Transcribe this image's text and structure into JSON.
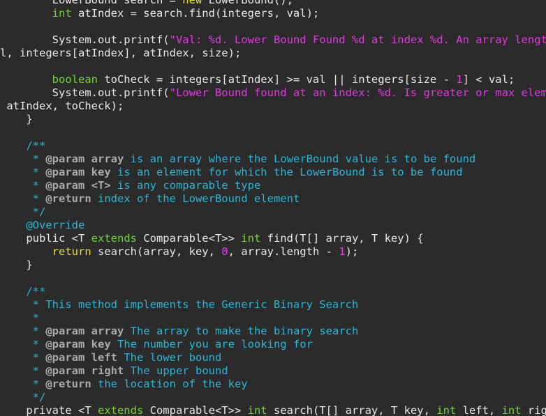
{
  "editor": {
    "colors": {
      "background": "#2b2b2b",
      "plain": "#e8e8e8",
      "keyword": "#e6de2b",
      "type": "#74d433",
      "string": "#de3bde",
      "number": "#ee3bee",
      "comment": "#2bb6d6",
      "javadoc_tag": "#a9a9a9",
      "javadoc_param": "#a9a9a9",
      "annotation": "#2bb6d6"
    },
    "lines": [
      [
        [
          "plain",
          "        LowerBound search = "
        ],
        [
          "keyword",
          "new"
        ],
        [
          "plain",
          " LowerBound();"
        ]
      ],
      [
        [
          "plain",
          "        "
        ],
        [
          "type",
          "int"
        ],
        [
          "plain",
          " atIndex = search.find(integers, val);"
        ]
      ],
      [
        [
          "plain",
          ""
        ]
      ],
      [
        [
          "plain",
          "        System.out.printf("
        ],
        [
          "string",
          "\"Val: %d. Lower Bound Found %d at index %d. An array length %"
        ]
      ],
      [
        [
          "plain",
          "l, integers[atIndex], atIndex, size);"
        ]
      ],
      [
        [
          "plain",
          ""
        ]
      ],
      [
        [
          "plain",
          "        "
        ],
        [
          "type",
          "boolean"
        ],
        [
          "plain",
          " toCheck = integers[atIndex] >= val || integers[size - "
        ],
        [
          "number",
          "1"
        ],
        [
          "plain",
          "] < val;"
        ]
      ],
      [
        [
          "plain",
          "        System.out.printf("
        ],
        [
          "string",
          "\"Lower Bound found at an index: %d. Is greater or max element"
        ]
      ],
      [
        [
          "plain",
          " atIndex, toCheck);"
        ]
      ],
      [
        [
          "plain",
          "    }"
        ]
      ],
      [
        [
          "plain",
          ""
        ]
      ],
      [
        [
          "comment",
          "    /**"
        ]
      ],
      [
        [
          "comment",
          "     * "
        ],
        [
          "javadoc_tag",
          "@param"
        ],
        [
          "comment",
          " "
        ],
        [
          "javadoc_param",
          "array"
        ],
        [
          "comment",
          " is an array where the LowerBound value is to be found"
        ]
      ],
      [
        [
          "comment",
          "     * "
        ],
        [
          "javadoc_tag",
          "@param"
        ],
        [
          "comment",
          " "
        ],
        [
          "javadoc_param",
          "key"
        ],
        [
          "comment",
          " is an element for which the LowerBound is to be found"
        ]
      ],
      [
        [
          "comment",
          "     * "
        ],
        [
          "javadoc_tag",
          "@param"
        ],
        [
          "comment",
          " "
        ],
        [
          "javadoc_param",
          "<T>"
        ],
        [
          "comment",
          " is any comparable type"
        ]
      ],
      [
        [
          "comment",
          "     * "
        ],
        [
          "javadoc_tag",
          "@return"
        ],
        [
          "comment",
          " index of the LowerBound element"
        ]
      ],
      [
        [
          "comment",
          "     */"
        ]
      ],
      [
        [
          "annotation",
          "    @Override"
        ]
      ],
      [
        [
          "plain",
          "    public <T "
        ],
        [
          "type",
          "extends"
        ],
        [
          "plain",
          " Comparable<T>> "
        ],
        [
          "type",
          "int"
        ],
        [
          "plain",
          " find(T[] array, T key) {"
        ]
      ],
      [
        [
          "plain",
          "        "
        ],
        [
          "keyword",
          "return"
        ],
        [
          "plain",
          " search(array, key, "
        ],
        [
          "number",
          "0"
        ],
        [
          "plain",
          ", array.length - "
        ],
        [
          "number",
          "1"
        ],
        [
          "plain",
          ");"
        ]
      ],
      [
        [
          "plain",
          "    }"
        ]
      ],
      [
        [
          "plain",
          ""
        ]
      ],
      [
        [
          "comment",
          "    /**"
        ]
      ],
      [
        [
          "comment",
          "     * This method implements the Generic Binary Search"
        ]
      ],
      [
        [
          "comment",
          "     *"
        ]
      ],
      [
        [
          "comment",
          "     * "
        ],
        [
          "javadoc_tag",
          "@param"
        ],
        [
          "comment",
          " "
        ],
        [
          "javadoc_param",
          "array"
        ],
        [
          "comment",
          " The array to make the binary search"
        ]
      ],
      [
        [
          "comment",
          "     * "
        ],
        [
          "javadoc_tag",
          "@param"
        ],
        [
          "comment",
          " "
        ],
        [
          "javadoc_param",
          "key"
        ],
        [
          "comment",
          " The number you are looking for"
        ]
      ],
      [
        [
          "comment",
          "     * "
        ],
        [
          "javadoc_tag",
          "@param"
        ],
        [
          "comment",
          " "
        ],
        [
          "javadoc_param",
          "left"
        ],
        [
          "comment",
          " The lower bound"
        ]
      ],
      [
        [
          "comment",
          "     * "
        ],
        [
          "javadoc_tag",
          "@param"
        ],
        [
          "comment",
          " "
        ],
        [
          "javadoc_param",
          "right"
        ],
        [
          "comment",
          " The upper bound"
        ]
      ],
      [
        [
          "comment",
          "     * "
        ],
        [
          "javadoc_tag",
          "@return"
        ],
        [
          "comment",
          " the location of the key"
        ]
      ],
      [
        [
          "comment",
          "     */"
        ]
      ],
      [
        [
          "plain",
          "    private <T "
        ],
        [
          "type",
          "extends"
        ],
        [
          "plain",
          " Comparable<T>> "
        ],
        [
          "type",
          "int"
        ],
        [
          "plain",
          " search(T[] array, T key, "
        ],
        [
          "type",
          "int"
        ],
        [
          "plain",
          " left, "
        ],
        [
          "type",
          "int"
        ],
        [
          "plain",
          " right)"
        ]
      ]
    ]
  }
}
